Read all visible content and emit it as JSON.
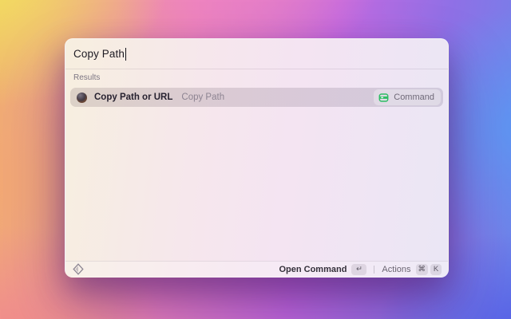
{
  "search": {
    "value": "Copy Path"
  },
  "results_header": "Results",
  "results": [
    {
      "title": "Copy Path or URL",
      "subtitle": "Copy Path",
      "accessory": {
        "label": "Command",
        "icon": "command-green-icon"
      }
    }
  ],
  "footer": {
    "primary_action": "Open Command",
    "primary_key": "↵",
    "secondary_action": "Actions",
    "secondary_keys": [
      "⌘",
      "K"
    ]
  },
  "colors": {
    "accent_green": "#2dbd64",
    "row_highlight": "rgba(108,92,112,0.20)",
    "bg_top_left": "#f2e15f",
    "bg_left": "#f3a874",
    "bg_bottom_left": "#f28c8c",
    "bg_top_center": "#ee82c4",
    "bg_right": "#5c98f3",
    "bg_bottom_right": "#565ee6"
  }
}
